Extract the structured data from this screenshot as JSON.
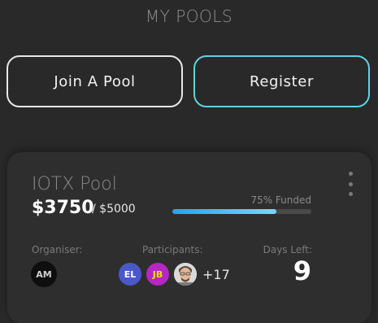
{
  "header": {
    "title": "MY POOLS"
  },
  "actions": {
    "join_label": "Join A Pool",
    "register_label": "Register"
  },
  "pool": {
    "name": "IOTX Pool",
    "raised": "$3750",
    "goal": "/ $5000",
    "funded_text": "75% Funded",
    "funded_fraction": 0.75,
    "organiser_label": "Organiser:",
    "participants_label": "Participants:",
    "days_left_label": "Days Left:",
    "organiser_initials": "AM",
    "participants": [
      {
        "initials": "EL"
      },
      {
        "initials": "JB"
      },
      {
        "initials": ""
      }
    ],
    "extra_participants": "+17",
    "days_left": "9"
  },
  "colors": {
    "background": "#292929",
    "card": "#2e2e2e",
    "accent": "#5fd2e6",
    "progress_start": "#2aa0ff",
    "progress_end": "#79d6ff"
  },
  "icons": {
    "menu": "vertical-dots-icon",
    "participant_photo": "user-photo-avatar"
  }
}
